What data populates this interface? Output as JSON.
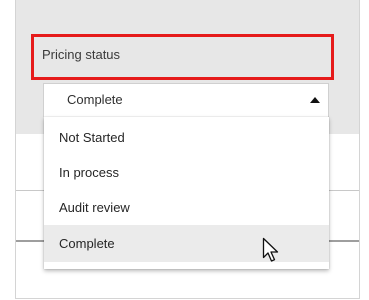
{
  "field": {
    "label": "Pricing status",
    "selected_value": "Complete"
  },
  "dropdown": {
    "options": [
      {
        "label": "Not Started",
        "selected": false
      },
      {
        "label": "In process",
        "selected": false
      },
      {
        "label": "Audit review",
        "selected": false
      },
      {
        "label": "Complete",
        "selected": true
      }
    ]
  },
  "icons": {
    "caret": "caret-up-icon",
    "cursor": "mouse-pointer-icon"
  },
  "colors": {
    "highlight": "#e61b1b",
    "header_background": "#e7e7e7",
    "selected_item_background": "#ebebeb"
  }
}
